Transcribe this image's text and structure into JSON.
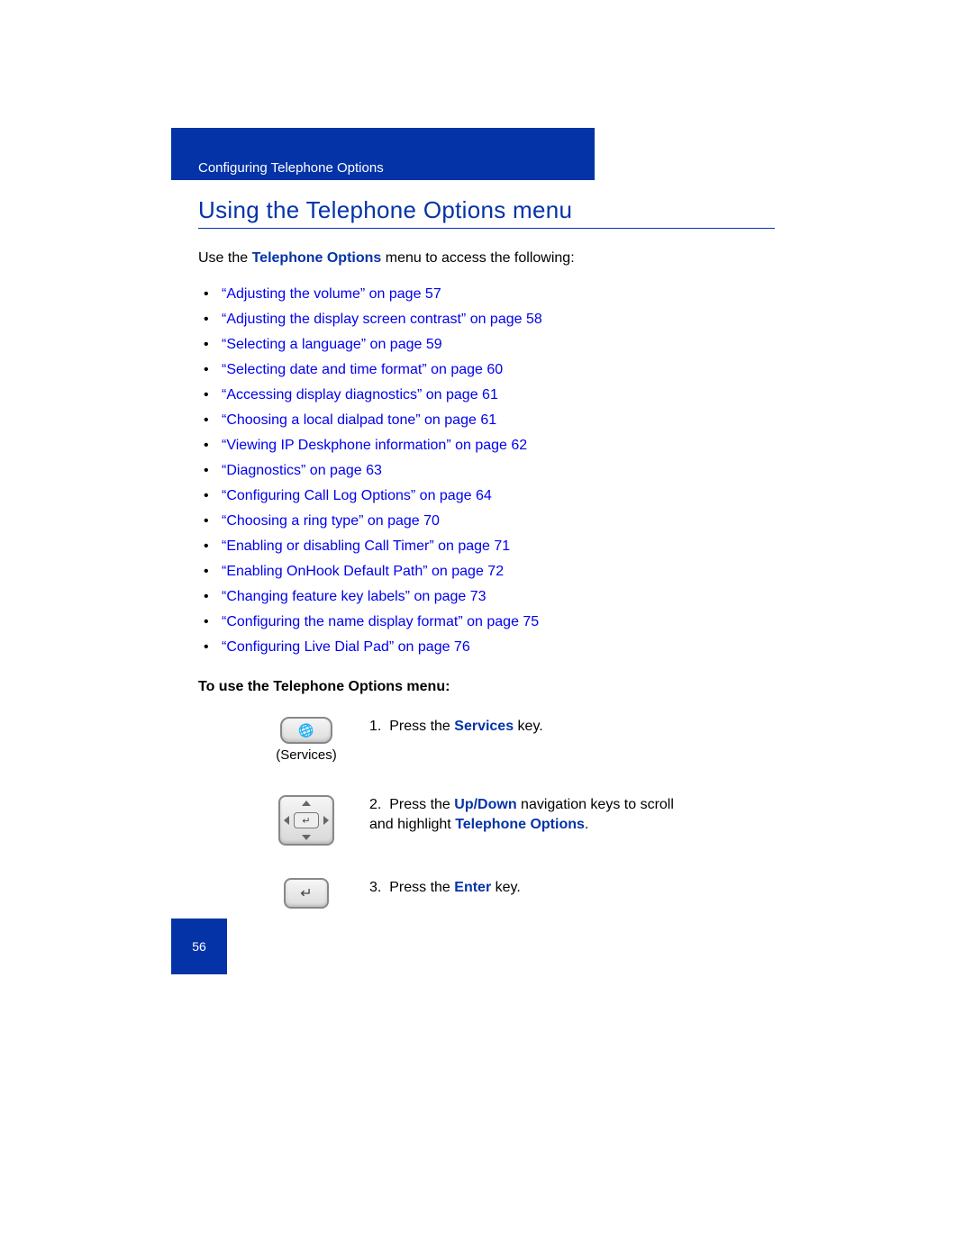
{
  "header": {
    "chapter": "Configuring Telephone Options"
  },
  "section": {
    "title": "Using the Telephone Options menu"
  },
  "intro": {
    "prefix": "Use the ",
    "emph": "Telephone Options",
    "suffix": " menu to access the following:"
  },
  "links": [
    "“Adjusting the volume” on page 57",
    "“Adjusting the display screen contrast” on page 58",
    "“Selecting a language” on page 59",
    "“Selecting date and time format” on page 60",
    "“Accessing display diagnostics” on page 61",
    "“Choosing a local dialpad tone” on page 61",
    "“Viewing IP Deskphone information” on page 62",
    "“Diagnostics” on page 63",
    "“Configuring Call Log Options” on page 64",
    "“Choosing a ring type” on page 70",
    "“Enabling or disabling Call Timer” on page 71",
    "“Enabling OnHook Default Path” on page 72",
    "“Changing feature key labels” on page 73",
    "“Configuring the name display format” on page 75",
    "“Configuring Live Dial Pad” on page 76"
  ],
  "subhead": "To use the Telephone Options menu:",
  "steps": {
    "s1": {
      "caption": "(Services)",
      "num": "1.",
      "t1": "Press the ",
      "emph": "Services",
      "t2": " key."
    },
    "s2": {
      "num": "2.",
      "t1": "Press the ",
      "emph1": "Up/Down",
      "t2": " navigation keys to scroll and highlight ",
      "emph2": "Telephone Options",
      "t3": "."
    },
    "s3": {
      "num": "3.",
      "t1": "Press the ",
      "emph": "Enter",
      "t2": " key."
    }
  },
  "page_number": "56"
}
